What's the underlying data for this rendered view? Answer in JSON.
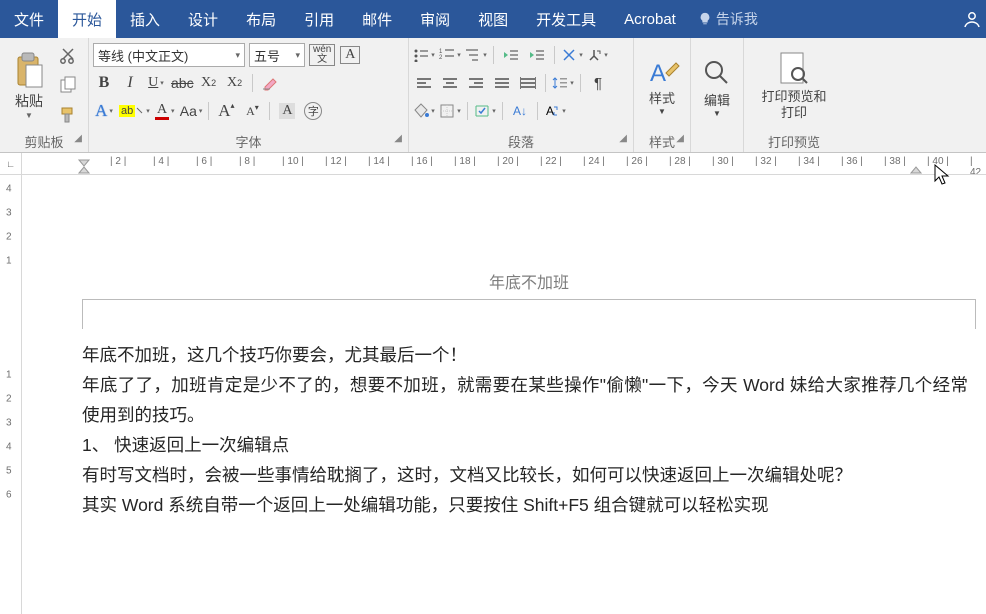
{
  "tabs": {
    "file": "文件",
    "home": "开始",
    "insert": "插入",
    "design": "设计",
    "layout": "布局",
    "references": "引用",
    "mail": "邮件",
    "review": "审阅",
    "view": "视图",
    "devtools": "开发工具",
    "acrobat": "Acrobat",
    "tellme": "告诉我"
  },
  "groups": {
    "clipboard": "剪贴板",
    "font": "字体",
    "paragraph": "段落",
    "styles": "样式",
    "editing": "编辑",
    "print_preview": "打印预览"
  },
  "clipboard": {
    "paste": "粘贴"
  },
  "font": {
    "name": "等线 (中文正文)",
    "size": "五号",
    "pinyin_top": "wén",
    "pinyin_bottom": "文",
    "bold": "B",
    "italic": "I",
    "underline": "U",
    "strikethrough": "abc",
    "subscript": "X₂",
    "superscript": "X²",
    "text_effects": "A",
    "highlight": "ab",
    "font_color": "A",
    "change_case": "Aa",
    "grow": "A",
    "shrink": "A",
    "char_shading": "A",
    "char_border": "字"
  },
  "styles": {
    "label": "样式"
  },
  "editing": {
    "label": "编辑"
  },
  "print": {
    "label_line1": "打印预览和",
    "label_line2": "打印"
  },
  "doc": {
    "header": "年底不加班",
    "p1": "年底不加班，这几个技巧你要会，尤其最后一个！",
    "p2": "年底了了，加班肯定是少不了的，想要不加班，就需要在某些操作\"偷懒\"一下，今天 Word 妹给大家推荐几个经常使用到的技巧。",
    "p3": "1、 快速返回上一次编辑点",
    "p4": "有时写文档时，会被一些事情给耽搁了，这时，文档又比较长，如何可以快速返回上一次编辑处呢？",
    "p5": "其实 Word 系统自带一个返回上一处编辑功能，只要按住 Shift+F5 组合键就可以轻松实现"
  },
  "ruler": {
    "h": [
      "2",
      "4",
      "6",
      "8",
      "10",
      "12",
      "14",
      "16",
      "18",
      "20",
      "22",
      "24",
      "26",
      "28",
      "30",
      "32",
      "34",
      "36",
      "38",
      "40",
      "42"
    ],
    "v_top": [
      "4",
      "3",
      "2",
      "1"
    ],
    "v_body": [
      "1",
      "2",
      "3",
      "4",
      "5",
      "6"
    ]
  }
}
